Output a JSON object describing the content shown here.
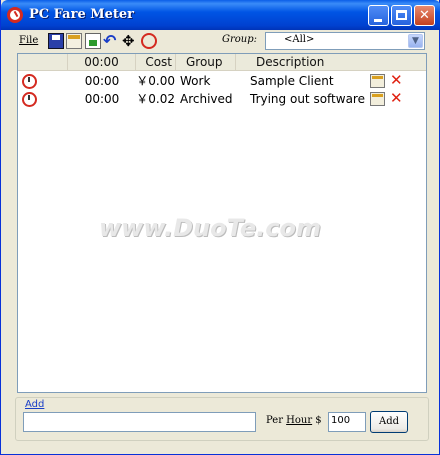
{
  "window": {
    "title": "PC Fare Meter"
  },
  "toolbar": {
    "file_menu": "File",
    "icons": [
      "save-icon",
      "properties-icon",
      "export-icon",
      "undo-icon",
      "move-icon",
      "clock-icon"
    ],
    "group_label": "Group:",
    "group_value": "<All>"
  },
  "list": {
    "columns": [
      "00:00",
      "Cost",
      "Group",
      "Description"
    ],
    "rows": [
      {
        "time": "00:00",
        "cost": "￥0.00",
        "group": "Work",
        "description": "Sample Client"
      },
      {
        "time": "00:00",
        "cost": "￥0.02",
        "group": "Archived",
        "description": "Trying out software"
      }
    ]
  },
  "watermark": "www.DuoTe.com",
  "add_panel": {
    "label": "Add",
    "description_value": "",
    "per_hour_label_prefix": "Per ",
    "per_hour_label_underlined": "Hour",
    "per_hour_label_suffix": " $",
    "rate_value": "100",
    "add_button_label": "Add"
  },
  "colors": {
    "titlebar": "#0055e5",
    "accent_red": "#d42a20",
    "link_blue": "#1a3ec8",
    "window_bg": "#ece9d8"
  }
}
